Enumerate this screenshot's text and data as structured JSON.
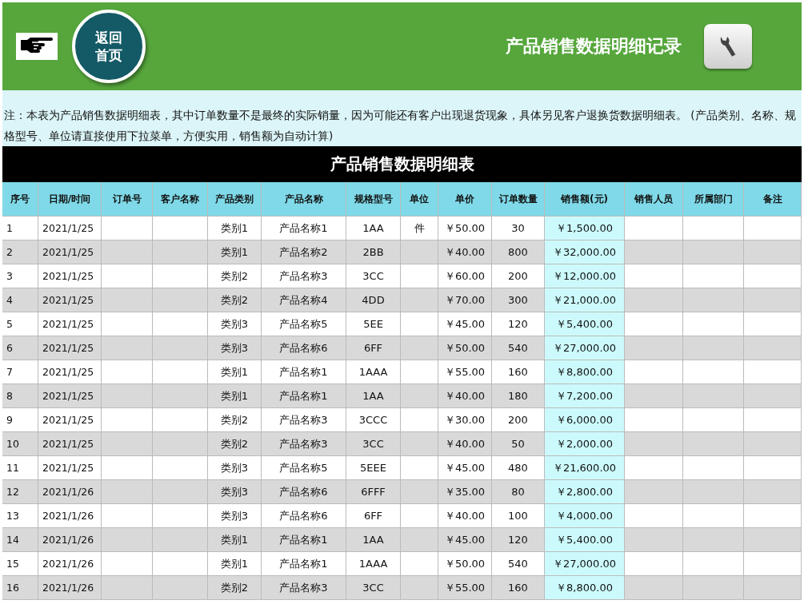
{
  "banner": {
    "pointer_label": "返回首页",
    "title": "产品销售数据明细记录"
  },
  "note": "注：本表为产品销售数据明细表，其中订单数量不是最终的实际销量，因为可能还有客户出现退货现象，具体另见客户退换货数据明细表。 (产品类别、名称、规格型号、单位请直接使用下拉菜单，方便实用，销售额为自动计算)",
  "table": {
    "title": "产品销售数据明细表",
    "columns": [
      "序号",
      "日期/时间",
      "订单号",
      "客户名称",
      "产品类别",
      "产品名称",
      "规格型号",
      "单位",
      "单价",
      "订单数量",
      "销售额(元)",
      "销售人员",
      "所属部门",
      "备注"
    ],
    "rows": [
      {
        "no": "1",
        "date": "2021/1/25",
        "category": "类别1",
        "name": "产品名称1",
        "spec": "1AA",
        "unit": "件",
        "price": "￥50.00",
        "qty": "30",
        "amount": "￥1,500.00"
      },
      {
        "no": "2",
        "date": "2021/1/25",
        "category": "类别1",
        "name": "产品名称2",
        "spec": "2BB",
        "price": "￥40.00",
        "qty": "800",
        "amount": "￥32,000.00"
      },
      {
        "no": "3",
        "date": "2021/1/25",
        "category": "类别2",
        "name": "产品名称3",
        "spec": "3CC",
        "price": "￥60.00",
        "qty": "200",
        "amount": "￥12,000.00"
      },
      {
        "no": "4",
        "date": "2021/1/25",
        "category": "类别2",
        "name": "产品名称4",
        "spec": "4DD",
        "price": "￥70.00",
        "qty": "300",
        "amount": "￥21,000.00"
      },
      {
        "no": "5",
        "date": "2021/1/25",
        "category": "类别3",
        "name": "产品名称5",
        "spec": "5EE",
        "price": "￥45.00",
        "qty": "120",
        "amount": "￥5,400.00"
      },
      {
        "no": "6",
        "date": "2021/1/25",
        "category": "类别3",
        "name": "产品名称6",
        "spec": "6FF",
        "price": "￥50.00",
        "qty": "540",
        "amount": "￥27,000.00"
      },
      {
        "no": "7",
        "date": "2021/1/25",
        "category": "类别1",
        "name": "产品名称1",
        "spec": "1AAA",
        "price": "￥55.00",
        "qty": "160",
        "amount": "￥8,800.00"
      },
      {
        "no": "8",
        "date": "2021/1/25",
        "category": "类别1",
        "name": "产品名称1",
        "spec": "1AA",
        "price": "￥40.00",
        "qty": "180",
        "amount": "￥7,200.00"
      },
      {
        "no": "9",
        "date": "2021/1/25",
        "category": "类别2",
        "name": "产品名称3",
        "spec": "3CCC",
        "price": "￥30.00",
        "qty": "200",
        "amount": "￥6,000.00"
      },
      {
        "no": "10",
        "date": "2021/1/25",
        "category": "类别2",
        "name": "产品名称3",
        "spec": "3CC",
        "price": "￥40.00",
        "qty": "50",
        "amount": "￥2,000.00"
      },
      {
        "no": "11",
        "date": "2021/1/25",
        "category": "类别3",
        "name": "产品名称5",
        "spec": "5EEE",
        "price": "￥45.00",
        "qty": "480",
        "amount": "￥21,600.00"
      },
      {
        "no": "12",
        "date": "2021/1/26",
        "category": "类别3",
        "name": "产品名称6",
        "spec": "6FFF",
        "price": "￥35.00",
        "qty": "80",
        "amount": "￥2,800.00"
      },
      {
        "no": "13",
        "date": "2021/1/26",
        "category": "类别3",
        "name": "产品名称6",
        "spec": "6FF",
        "price": "￥40.00",
        "qty": "100",
        "amount": "￥4,000.00"
      },
      {
        "no": "14",
        "date": "2021/1/26",
        "category": "类别1",
        "name": "产品名称1",
        "spec": "1AA",
        "price": "￥45.00",
        "qty": "120",
        "amount": "￥5,400.00"
      },
      {
        "no": "15",
        "date": "2021/1/26",
        "category": "类别1",
        "name": "产品名称1",
        "spec": "1AAA",
        "price": "￥50.00",
        "qty": "540",
        "amount": "￥27,000.00"
      },
      {
        "no": "16",
        "date": "2021/1/26",
        "category": "类别2",
        "name": "产品名称3",
        "spec": "3CC",
        "price": "￥55.00",
        "qty": "160",
        "amount": "￥8,800.00"
      }
    ]
  }
}
